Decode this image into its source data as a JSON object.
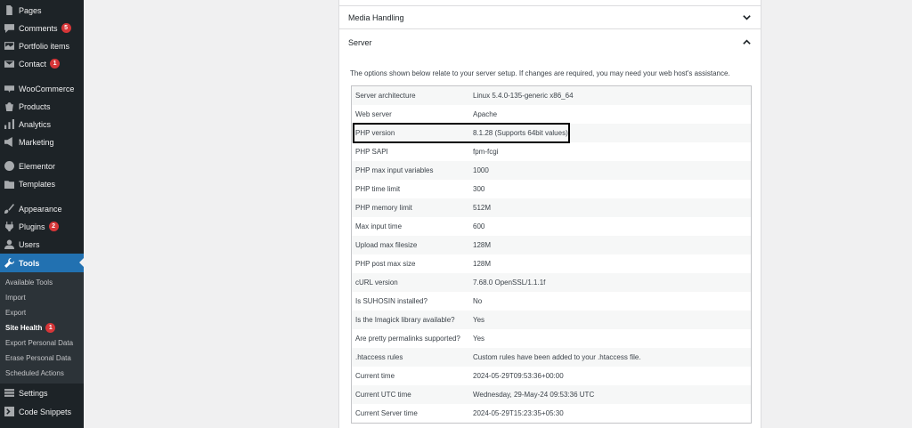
{
  "sidebar": {
    "items": [
      {
        "label": "Pages",
        "icon": "pages-icon",
        "top": 0
      },
      {
        "label": "Comments",
        "icon": "comments-icon",
        "badge": "5"
      },
      {
        "label": "Portfolio items",
        "icon": "portfolio-icon"
      },
      {
        "label": "Contact",
        "icon": "contact-icon",
        "badge": "1"
      },
      {
        "label": "WooCommerce",
        "icon": "woocommerce-icon"
      },
      {
        "label": "Products",
        "icon": "products-icon"
      },
      {
        "label": "Analytics",
        "icon": "analytics-icon"
      },
      {
        "label": "Marketing",
        "icon": "marketing-icon"
      },
      {
        "label": "Elementor",
        "icon": "elementor-icon"
      },
      {
        "label": "Templates",
        "icon": "templates-icon"
      },
      {
        "label": "Appearance",
        "icon": "appearance-icon"
      },
      {
        "label": "Plugins",
        "icon": "plugins-icon",
        "badge": "2"
      },
      {
        "label": "Users",
        "icon": "users-icon"
      },
      {
        "label": "Tools",
        "icon": "tools-icon"
      },
      {
        "label": "Settings",
        "icon": "settings-icon"
      },
      {
        "label": "Code Snippets",
        "icon": "code-snippets-icon"
      }
    ],
    "tools_submenu": [
      {
        "label": "Available Tools"
      },
      {
        "label": "Import"
      },
      {
        "label": "Export"
      },
      {
        "label": "Site Health",
        "badge": "1"
      },
      {
        "label": "Export Personal Data"
      },
      {
        "label": "Erase Personal Data"
      },
      {
        "label": "Scheduled Actions"
      }
    ]
  },
  "panel": {
    "media_handling": "Media Handling",
    "server": "Server",
    "description": "The options shown below relate to your server setup. If changes are required, you may need your web host's assistance.",
    "rows": [
      {
        "key": "Server architecture",
        "value": "Linux 5.4.0-135-generic x86_64"
      },
      {
        "key": "Web server",
        "value": "Apache"
      },
      {
        "key": "PHP version",
        "value": "8.1.28 (Supports 64bit values)"
      },
      {
        "key": "PHP SAPI",
        "value": "fpm-fcgi"
      },
      {
        "key": "PHP max input variables",
        "value": "1000"
      },
      {
        "key": "PHP time limit",
        "value": "300"
      },
      {
        "key": "PHP memory limit",
        "value": "512M"
      },
      {
        "key": "Max input time",
        "value": "600"
      },
      {
        "key": "Upload max filesize",
        "value": "128M"
      },
      {
        "key": "PHP post max size",
        "value": "128M"
      },
      {
        "key": "cURL version",
        "value": "7.68.0 OpenSSL/1.1.1f"
      },
      {
        "key": "Is SUHOSIN installed?",
        "value": "No"
      },
      {
        "key": "Is the Imagick library available?",
        "value": "Yes"
      },
      {
        "key": "Are pretty permalinks supported?",
        "value": "Yes"
      },
      {
        "key": ".htaccess rules",
        "value": "Custom rules have been added to your .htaccess file."
      },
      {
        "key": "Current time",
        "value": "2024-05-29T09:53:36+00:00"
      },
      {
        "key": "Current UTC time",
        "value": "Wednesday, 29-May-24 09:53:36 UTC"
      },
      {
        "key": "Current Server time",
        "value": "2024-05-29T15:23:35+05:30"
      }
    ]
  },
  "colors": {
    "sidebar_bg": "#1d2327",
    "current_bg": "#2271b1",
    "badge_bg": "#d63638"
  }
}
